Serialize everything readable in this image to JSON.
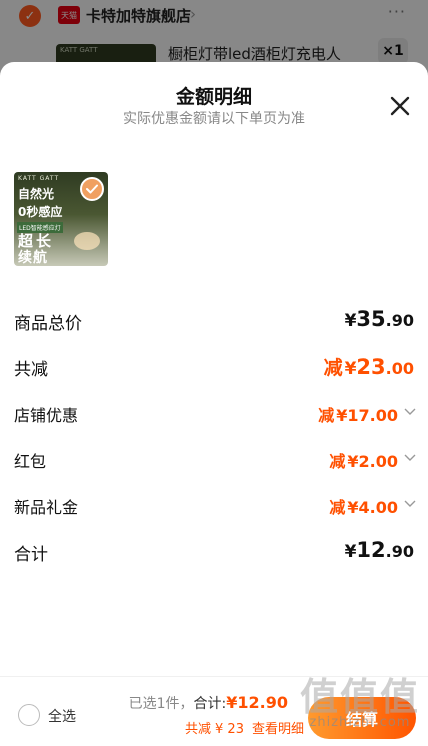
{
  "background": {
    "store_badge": "天猫",
    "store_name": "卡特加特旗舰店",
    "product_title": "橱柜灯带led酒柜灯充电人",
    "product_brand": "KATT GATT",
    "qty": "×1",
    "more": "···"
  },
  "sheet": {
    "title": "金额明细",
    "subtitle": "实际优惠金额请以下单页为准",
    "product_image": {
      "brand": "KATT GATT",
      "line1": "自然光",
      "line2": "0秒感应",
      "small": "LED智能感应灯",
      "big1": "超长",
      "big2": "续航"
    },
    "rows": {
      "total": {
        "label": "商品总价",
        "cur": "¥",
        "int": "35",
        "dec": ".90"
      },
      "reduce": {
        "label": "共减",
        "prefix": "减",
        "cur": "¥",
        "int": "23",
        "dec": ".00"
      },
      "store_discount": {
        "label": "店铺优惠",
        "prefix": "减",
        "cur": "¥",
        "int": "17",
        "dec": ".00"
      },
      "red_packet": {
        "label": "红包",
        "prefix": "减",
        "cur": "¥",
        "int": "2",
        "dec": ".00"
      },
      "new_gift": {
        "label": "新品礼金",
        "prefix": "减",
        "cur": "¥",
        "int": "4",
        "dec": ".00"
      },
      "sum": {
        "label": "合计",
        "cur": "¥",
        "int": "12",
        "dec": ".90"
      }
    }
  },
  "bottom": {
    "select_all": "全选",
    "selected_count": "已选1件，",
    "total_label": "合计:",
    "total_value": "¥12.90",
    "reduced_label": "共减",
    "reduced_value": "¥ 23",
    "view_detail": "查看明细",
    "checkout": "结算"
  },
  "watermark": {
    "big": "值值值",
    "small": "zhizhizhi.com"
  },
  "colors": {
    "accent": "#ff5000",
    "overlay": "rgba(0,0,0,0.45)"
  }
}
